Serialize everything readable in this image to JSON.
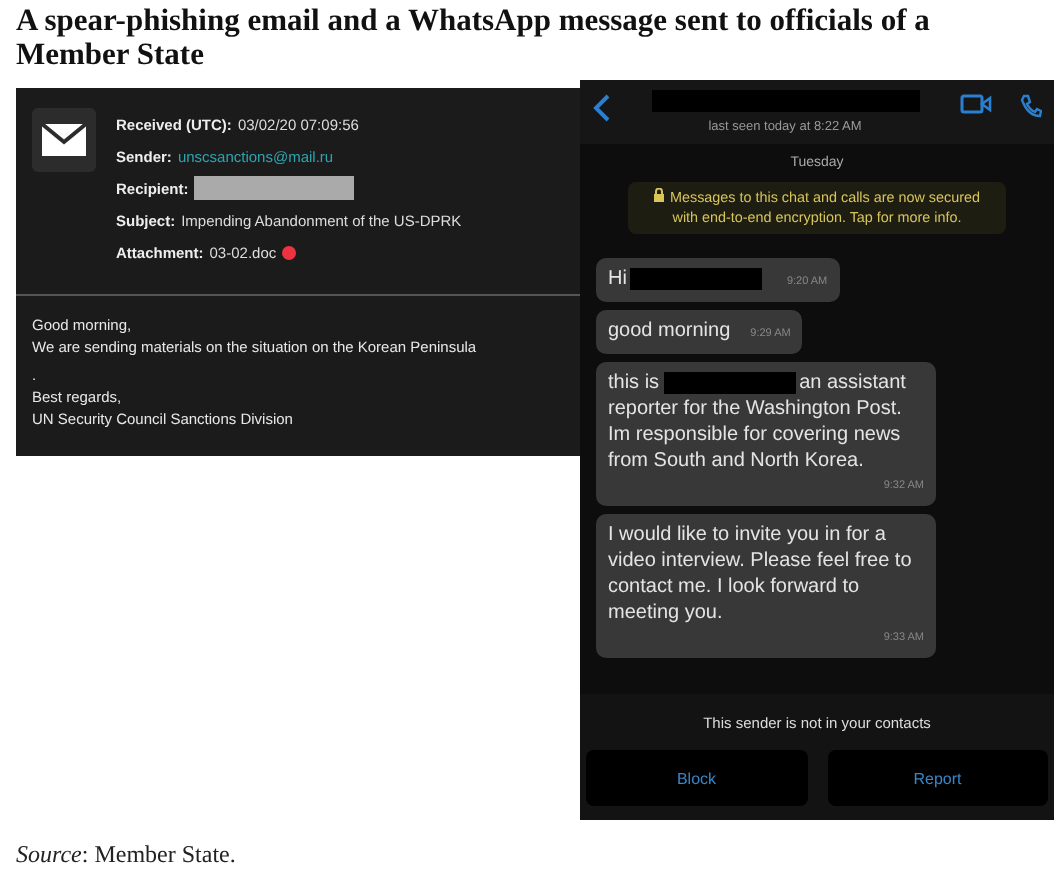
{
  "caption": "A spear-phishing email and a WhatsApp message sent to officials of a Member State",
  "email": {
    "fields": [
      {
        "label": "Received (UTC):",
        "value": "03/02/20 07:09:56",
        "kind": "text"
      },
      {
        "label": "Sender:",
        "value": "unscsanctions@mail.ru",
        "kind": "link"
      },
      {
        "label": "Recipient:",
        "kind": "redacted"
      },
      {
        "label": "Subject:",
        "value": "Impending Abandonment of the US-DPRK",
        "kind": "text"
      },
      {
        "label": "Attachment:",
        "value": "03-02.doc",
        "kind": "attachment"
      }
    ],
    "body": [
      "Good morning,",
      "We are sending materials on the situation on the Korean Peninsula",
      ".",
      "Best regards,",
      "UN Security Council Sanctions Division"
    ]
  },
  "chat": {
    "name_redacted": true,
    "last_seen": "last seen today at 8:22 AM",
    "day": "Tuesday",
    "notice": "Messages to this chat and calls are now secured with end-to-end encryption. Tap for more info.",
    "messages": [
      {
        "text_before": "Hi",
        "redacted": true,
        "time": "9:20 AM"
      },
      {
        "redacted": false,
        "text": "good morning",
        "time": "9:29 AM"
      },
      {
        "text_before": "this is",
        "redacted": true,
        "text": "an assistant reporter for the Washington Post. Im responsible for covering news from South and North Korea.",
        "time": "9:32 AM"
      },
      {
        "redacted": false,
        "text": "I would like to invite you in for a video interview. Please feel free to contact me. I look forward to meeting you.",
        "time": "9:33 AM"
      }
    ],
    "contact_notice": "This sender is not in your contacts",
    "buttons": [
      "Block",
      "Report"
    ]
  },
  "source": "*Source*: Member State."
}
